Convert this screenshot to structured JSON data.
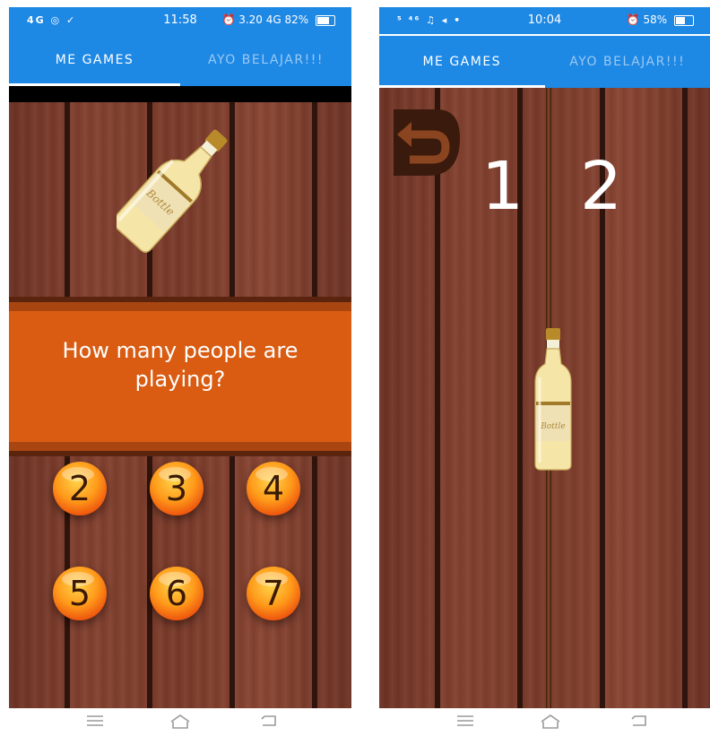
{
  "left": {
    "status": {
      "left_icons": "4G ◎ ✓",
      "time": "11:58",
      "right": "⏰ 3.20 4G 82%"
    },
    "tabs": [
      {
        "label": "ME GAMES"
      },
      {
        "label": "AYO BELAJAR!!!"
      }
    ],
    "question": "How many people are playing?",
    "buttons": [
      "2",
      "3",
      "4",
      "5",
      "6",
      "7"
    ]
  },
  "right": {
    "status": {
      "left_icons": "⁵ ⁴⁶ ♫ ◂ •",
      "time": "10:04",
      "right": "⏰ 58%"
    },
    "tabs": [
      {
        "label": "ME GAMES"
      },
      {
        "label": "AYO BELAJAR!!!"
      }
    ],
    "players": [
      "1",
      "2"
    ]
  },
  "colors": {
    "appbar": "#1e88e5",
    "banner": "#d95c12",
    "wood": "#7a3a29"
  },
  "icons": {
    "nav_menu": "menu-icon",
    "nav_home": "home-icon",
    "nav_back": "back-icon",
    "restart": "undo-icon"
  }
}
